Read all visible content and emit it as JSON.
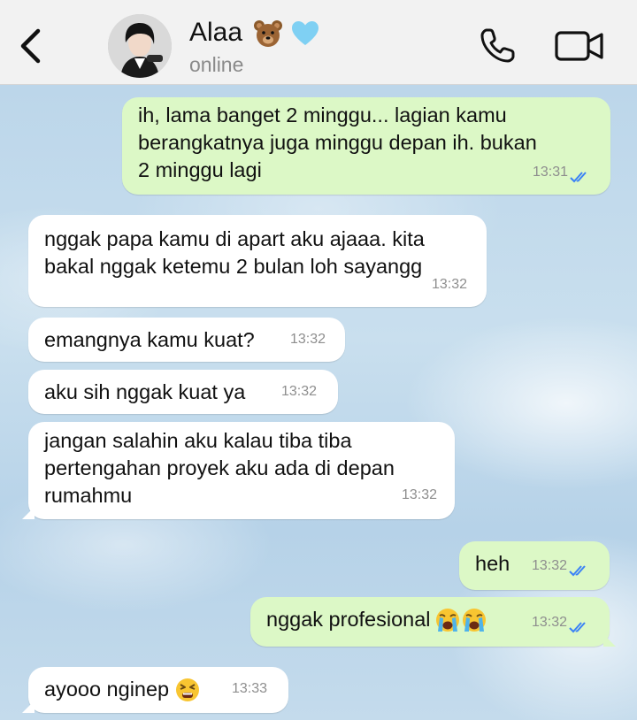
{
  "header": {
    "contact_name": "Alaa",
    "status": "online",
    "icons": [
      "back-chevron-icon",
      "bear-emoji-icon",
      "blue-heart-emoji-icon",
      "phone-icon",
      "video-camera-icon"
    ]
  },
  "messages": [
    {
      "direction": "out",
      "lines": [
        "ih, lama banget 2 minggu... lagian kamu",
        "berangkatnya juga minggu depan ih. bukan",
        "2 minggu lagi"
      ],
      "time": "13:31",
      "read": true
    },
    {
      "direction": "in",
      "lines": [
        "nggak papa kamu di apart aku ajaaa. kita",
        "bakal nggak ketemu 2 bulan loh sayangg"
      ],
      "time": "13:32"
    },
    {
      "direction": "in",
      "lines": [
        "emangnya kamu kuat?"
      ],
      "time": "13:32"
    },
    {
      "direction": "in",
      "lines": [
        "aku sih nggak kuat ya"
      ],
      "time": "13:32"
    },
    {
      "direction": "in",
      "lines": [
        "jangan salahin aku kalau tiba tiba",
        "pertengahan proyek aku ada di depan",
        "rumahmu"
      ],
      "time": "13:32"
    },
    {
      "direction": "out",
      "lines": [
        "heh"
      ],
      "time": "13:32",
      "read": true
    },
    {
      "direction": "out",
      "lines": [
        "nggak profesional"
      ],
      "emoji": [
        "loudly-crying-face",
        "loudly-crying-face"
      ],
      "time": "13:32",
      "read": true
    },
    {
      "direction": "in",
      "lines": [
        "ayooo nginep"
      ],
      "emoji": [
        "tired-face"
      ],
      "time": "13:33"
    }
  ],
  "colors": {
    "outgoing_bubble": "#dcf8c6",
    "incoming_bubble": "#ffffff",
    "read_ticks": "#3b82f6",
    "header_bg": "#f2f2f2"
  }
}
